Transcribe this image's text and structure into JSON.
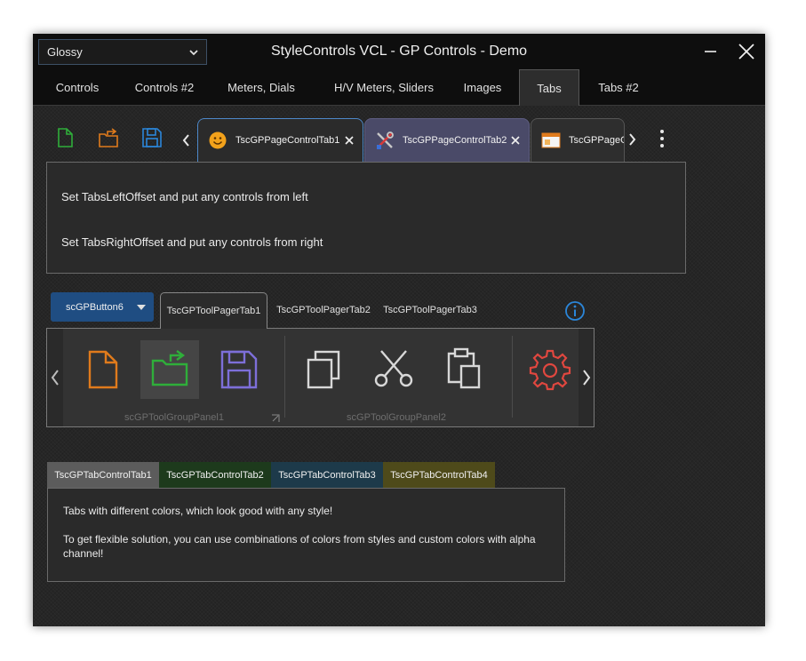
{
  "titlebar": {
    "style_combo_value": "Glossy",
    "title": "StyleControls VCL - GP Controls - Demo"
  },
  "main_tabs": [
    {
      "label": "Controls"
    },
    {
      "label": "Controls #2"
    },
    {
      "label": "Meters, Dials"
    },
    {
      "label": "H/V Meters, Sliders"
    },
    {
      "label": "Images"
    },
    {
      "label": "Tabs",
      "active": true
    },
    {
      "label": "Tabs #2"
    }
  ],
  "page_control": {
    "tabs": [
      {
        "label": "TscGPPageControlTab1",
        "icon": "smiley-icon"
      },
      {
        "label": "TscGPPageControlTab2",
        "icon": "tools-icon"
      },
      {
        "label": "TscGPPageCo",
        "icon": "window-icon"
      }
    ],
    "lines": [
      "Set TabsLeftOffset and put any controls from left",
      "Set TabsRightOffset and put any controls from right"
    ]
  },
  "tool_pager": {
    "button_label": "scGPButton6",
    "tabs": [
      {
        "label": "TscGPToolPagerTab1"
      },
      {
        "label": "TscGPToolPagerTab2"
      },
      {
        "label": "TscGPToolPagerTab3"
      }
    ],
    "groups": [
      {
        "label": "scGPToolGroupPanel1"
      },
      {
        "label": "scGPToolGroupPanel2"
      }
    ]
  },
  "tab_control": {
    "tabs": [
      {
        "label": "TscGPTabControlTab1",
        "color": "#5c5c5c"
      },
      {
        "label": "TscGPTabControlTab2",
        "color": "#1d3a1c"
      },
      {
        "label": "TscGPTabControlTab3",
        "color": "#1d3a4a"
      },
      {
        "label": "TscGPTabControlTab4",
        "color": "#4e4a1a"
      }
    ],
    "paragraphs": [
      "Tabs with different colors, which look good with any style!",
      "To get flexible solution, you can use combinations of colors from styles and custom colors with alpha channel!"
    ]
  },
  "colors": {
    "accent_blue": "#4d88c9",
    "icon_green": "#2fae3a",
    "icon_orange": "#e07b1c",
    "icon_blue": "#2b86d9",
    "icon_purple": "#7d6fd9",
    "icon_red": "#e0473f"
  }
}
